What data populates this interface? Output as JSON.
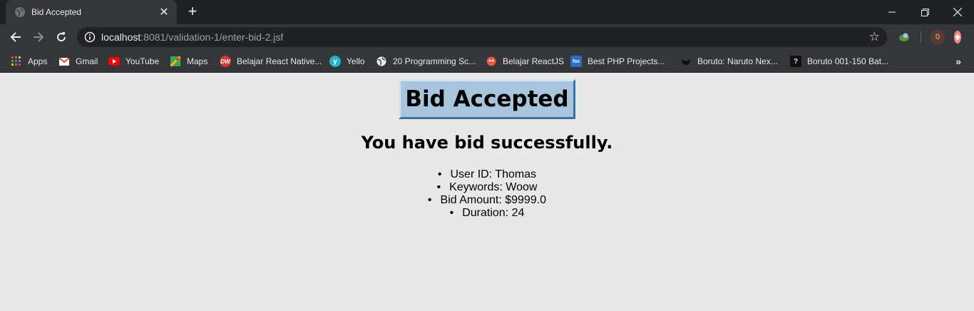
{
  "browser": {
    "tab": {
      "title": "Bid Accepted"
    },
    "address": {
      "host": "localhost",
      "rest": ":8081/validation-1/enter-bid-2.jsf"
    },
    "profile_badge": "0",
    "bookmarks": [
      {
        "label": "Apps",
        "icon": "apps-grid-icon"
      },
      {
        "label": "Gmail",
        "icon": "gmail-icon"
      },
      {
        "label": "YouTube",
        "icon": "youtube-icon"
      },
      {
        "label": "Maps",
        "icon": "maps-icon"
      },
      {
        "label": "Belajar React Native...",
        "icon": "dw-icon"
      },
      {
        "label": "Yello",
        "icon": "yello-icon"
      },
      {
        "label": "20 Programming Sc...",
        "icon": "globe-icon"
      },
      {
        "label": "Belajar ReactJS",
        "icon": "reactjs-icon"
      },
      {
        "label": "Best PHP Projects...",
        "icon": "fsc-icon"
      },
      {
        "label": "Boruto: Naruto Nex...",
        "icon": "cat-icon"
      },
      {
        "label": "Boruto 001-150 Bat...",
        "icon": "question-icon"
      }
    ]
  },
  "page": {
    "heading": "Bid Accepted",
    "subheading": "You have bid successfully.",
    "details": [
      "User ID: Thomas",
      "Keywords: Woow",
      "Bid Amount: $9999.0",
      "Duration: 24"
    ]
  },
  "colors": {
    "page_background": "#e8e8e8",
    "heading_box": "#a9c4dd",
    "chrome_dark": "#202124",
    "chrome_toolbar": "#35363a"
  }
}
